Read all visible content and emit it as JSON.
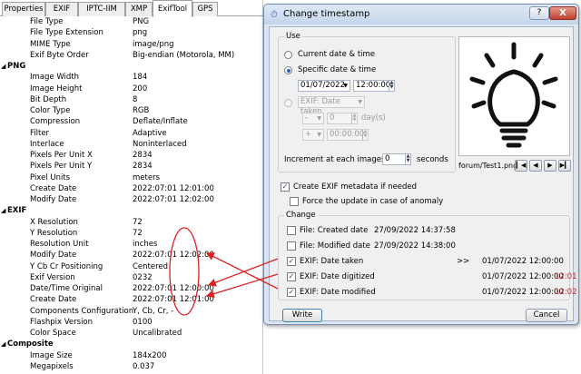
{
  "left_panel": {
    "tabs": [
      "Properties",
      "EXIF",
      "IPTC-IIM",
      "XMP",
      "ExifTool",
      "GPS"
    ],
    "active_tab": "ExifTool",
    "rows": [
      {
        "type": "item",
        "key": "File Type",
        "value": "PNG"
      },
      {
        "type": "item",
        "key": "File Type Extension",
        "value": "png"
      },
      {
        "type": "item",
        "key": "MIME Type",
        "value": "image/png"
      },
      {
        "type": "item",
        "key": "Exif Byte Order",
        "value": "Big-endian (Motorola, MM)"
      },
      {
        "type": "group",
        "key": "PNG"
      },
      {
        "type": "item",
        "key": "Image Width",
        "value": "184"
      },
      {
        "type": "item",
        "key": "Image Height",
        "value": "200"
      },
      {
        "type": "item",
        "key": "Bit Depth",
        "value": "8"
      },
      {
        "type": "item",
        "key": "Color Type",
        "value": "RGB"
      },
      {
        "type": "item",
        "key": "Compression",
        "value": "Deflate/Inflate"
      },
      {
        "type": "item",
        "key": "Filter",
        "value": "Adaptive"
      },
      {
        "type": "item",
        "key": "Interlace",
        "value": "Noninterlaced"
      },
      {
        "type": "item",
        "key": "Pixels Per Unit X",
        "value": "2834"
      },
      {
        "type": "item",
        "key": "Pixels Per Unit Y",
        "value": "2834"
      },
      {
        "type": "item",
        "key": "Pixel Units",
        "value": "meters"
      },
      {
        "type": "item",
        "key": "Create Date",
        "value": "2022:07:01 12:01:00"
      },
      {
        "type": "item",
        "key": "Modify Date",
        "value": "2022:07:01 12:02:00"
      },
      {
        "type": "group",
        "key": "EXIF"
      },
      {
        "type": "item",
        "key": "X Resolution",
        "value": "72"
      },
      {
        "type": "item",
        "key": "Y Resolution",
        "value": "72"
      },
      {
        "type": "item",
        "key": "Resolution Unit",
        "value": "inches"
      },
      {
        "type": "item",
        "key": "Modify Date",
        "value": "2022:07:01 12:02:00"
      },
      {
        "type": "item",
        "key": "Y Cb Cr Positioning",
        "value": "Centered"
      },
      {
        "type": "item",
        "key": "Exif Version",
        "value": "0232"
      },
      {
        "type": "item",
        "key": "Date/Time Original",
        "value": "2022:07:01 12:00:00"
      },
      {
        "type": "item",
        "key": "Create Date",
        "value": "2022:07:01 12:01:00"
      },
      {
        "type": "item",
        "key": "Components Configuration",
        "value": "Y, Cb, Cr, -"
      },
      {
        "type": "item",
        "key": "Flashpix Version",
        "value": "0100"
      },
      {
        "type": "item",
        "key": "Color Space",
        "value": "Uncalibrated"
      },
      {
        "type": "group",
        "key": "Composite"
      },
      {
        "type": "item",
        "key": "Image Size",
        "value": "184x200"
      },
      {
        "type": "item",
        "key": "Megapixels",
        "value": "0.037"
      }
    ]
  },
  "dialog": {
    "title": "Change timestamp",
    "help_label": "?",
    "close_label": "X",
    "use_group": {
      "label": "Use",
      "current_label": "Current date & time",
      "specific_label": "Specific date & time",
      "date_value": "01/07/2022",
      "time_value": "12:00:00",
      "exif_combo": "EXIF: Date taken",
      "minus_label": "-",
      "plus_label": "+",
      "days_value": "0",
      "days_label": "day(s)",
      "offset_time": "00:00:00",
      "increment_label": "Increment at each images by",
      "increment_value": "0",
      "seconds_label": "seconds"
    },
    "preview": {
      "filename": "forum/Test1.png"
    },
    "create_exif_label": "Create EXIF metadata if needed",
    "force_update_label": "Force the update in case of anomaly",
    "change_group": {
      "label": "Change",
      "rows": [
        {
          "label": "File: Created date",
          "old": "27/09/2022 14:37:58",
          "arrow": "",
          "new": "",
          "note": "",
          "checked": false
        },
        {
          "label": "File: Modified date",
          "old": "27/09/2022 14:38:00",
          "arrow": "",
          "new": "",
          "note": "",
          "checked": false
        },
        {
          "label": "EXIF: Date taken",
          "old": "",
          "arrow": ">>",
          "new": "01/07/2022 12:00:00",
          "note": "",
          "checked": true
        },
        {
          "label": "EXIF: Date digitized",
          "old": "",
          "arrow": "",
          "new": "01/07/2022 12:00:00",
          "note": "12:01",
          "checked": true
        },
        {
          "label": "EXIF: Date modified",
          "old": "",
          "arrow": "",
          "new": "01/07/2022 12:00:00",
          "note": "12:02",
          "checked": true
        }
      ]
    },
    "write_label": "Write",
    "cancel_label": "Cancel"
  },
  "annotation_color": "#e02020"
}
